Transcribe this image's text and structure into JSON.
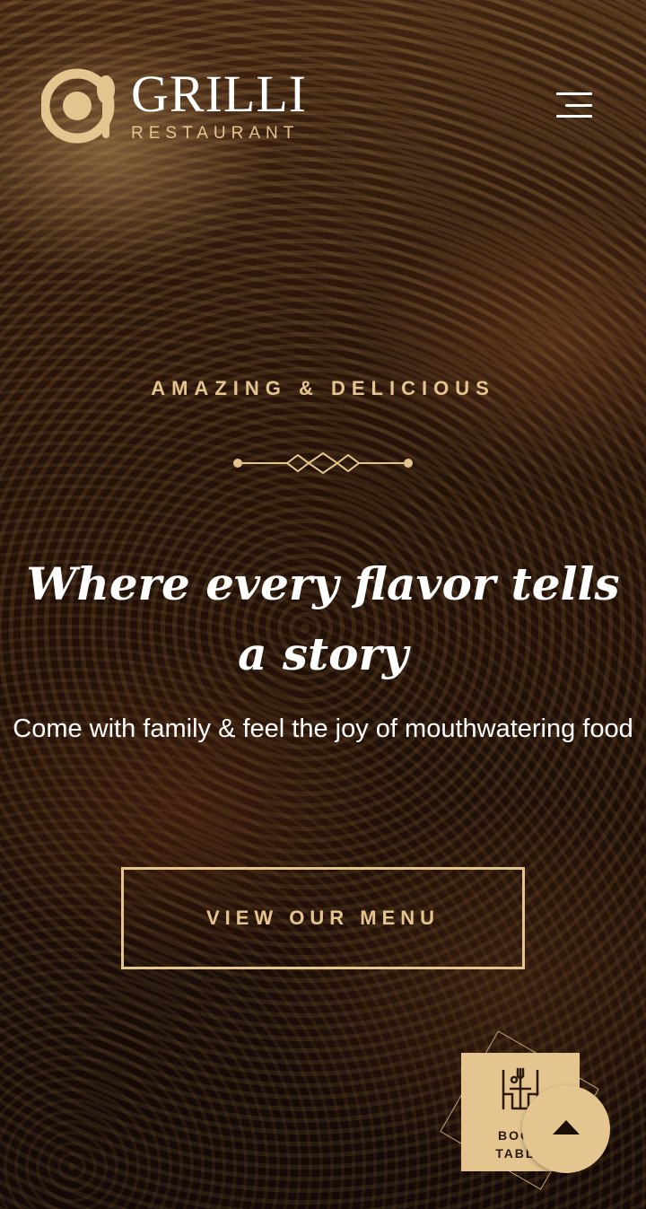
{
  "brand": {
    "title": "GRILLI",
    "subtitle": "RESTAURANT",
    "accent_color": "#e4c590"
  },
  "header": {
    "menu_icon": "hamburger-menu-icon"
  },
  "hero": {
    "eyebrow": "AMAZING & DELICIOUS",
    "headline": "Where every flavor tells a story",
    "subtext": "Come with family & feel the joy of mouthwatering food",
    "cta_label": "VIEW OUR MENU"
  },
  "book_table": {
    "label": "BOOK TABLE",
    "icon": "dining-table-icon"
  },
  "scroll_top": {
    "icon": "chevron-up-icon"
  }
}
